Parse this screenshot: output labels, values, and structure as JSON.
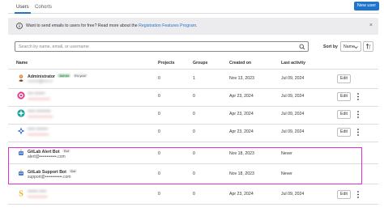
{
  "tabs": [
    {
      "label": "Users",
      "active": true
    },
    {
      "label": "Cohorts",
      "active": false
    }
  ],
  "new_user_label": "New user",
  "alert": {
    "text": "Want to send emails to users for free? Read more about the",
    "link": "Registration Features Program",
    "end": ".",
    "close_glyph": "×"
  },
  "search": {
    "placeholder": "Search by name, email, or username",
    "value": ""
  },
  "sort": {
    "label": "Sort by",
    "value": "Name"
  },
  "columns": {
    "name": "Name",
    "projects": "Projects",
    "groups": "Groups",
    "created_on": "Created on",
    "last_activity": "Last activity"
  },
  "edit_label": "Edit",
  "rows": [
    {
      "name": "Administrator",
      "badges": [
        "Admin",
        "It's you!"
      ],
      "email": "••••••••@••••.••",
      "projects": "0",
      "groups": "1",
      "created_on": "Nov 13, 2023",
      "last_activity": "Jul 09, 2024",
      "avatar": "administrator",
      "kebab": false,
      "blurred": false
    },
    {
      "name": "•••• •••••••",
      "badges": [],
      "email": "••••••••••••••••",
      "projects": "0",
      "groups": "0",
      "created_on": "Apr 23, 2024",
      "last_activity": "Jul 09, 2024",
      "avatar": "pink-identicon",
      "kebab": true,
      "blurred": true
    },
    {
      "name": "••••• ••••••••••",
      "badges": [],
      "email": "••••••••••••••••••",
      "projects": "0",
      "groups": "0",
      "created_on": "Apr 23, 2024",
      "last_activity": "Jul 09, 2024",
      "avatar": "teal-identicon",
      "kebab": true,
      "blurred": true
    },
    {
      "name": "••••• ••••••••",
      "badges": [],
      "email": "•••••••••••••••",
      "projects": "0",
      "groups": "0",
      "created_on": "Apr 23, 2024",
      "last_activity": "Jul 09, 2024",
      "avatar": "blue-identicon",
      "kebab": true,
      "blurred": true
    },
    {
      "name": "GitLab Alert Bot",
      "badges": [
        "Bot"
      ],
      "email": "alert@••••••••••••.com",
      "projects": "0",
      "groups": "0",
      "created_on": "Nov 18, 2023",
      "last_activity": "Never",
      "avatar": "bot",
      "kebab": false,
      "blurred": false
    },
    {
      "name": "GitLab Support Bot",
      "badges": [
        "Bot"
      ],
      "email": "support@••••••••••••.com",
      "projects": "0",
      "groups": "0",
      "created_on": "Nov 18, 2023",
      "last_activity": "Never",
      "avatar": "bot",
      "kebab": false,
      "blurred": false
    },
    {
      "name": "••••••• •••••",
      "badges": [],
      "email": "••••••••••••••",
      "projects": "0",
      "groups": "0",
      "created_on": "Apr 23, 2024",
      "last_activity": "Jul 09, 2024",
      "avatar": "yellow-s",
      "kebab": true,
      "blurred": true
    }
  ],
  "colors": {
    "accent": "#1f75cb",
    "highlight": "#e32fd8",
    "admin_badge": "#c3e6cd",
    "alert_bg": "#ececef"
  }
}
